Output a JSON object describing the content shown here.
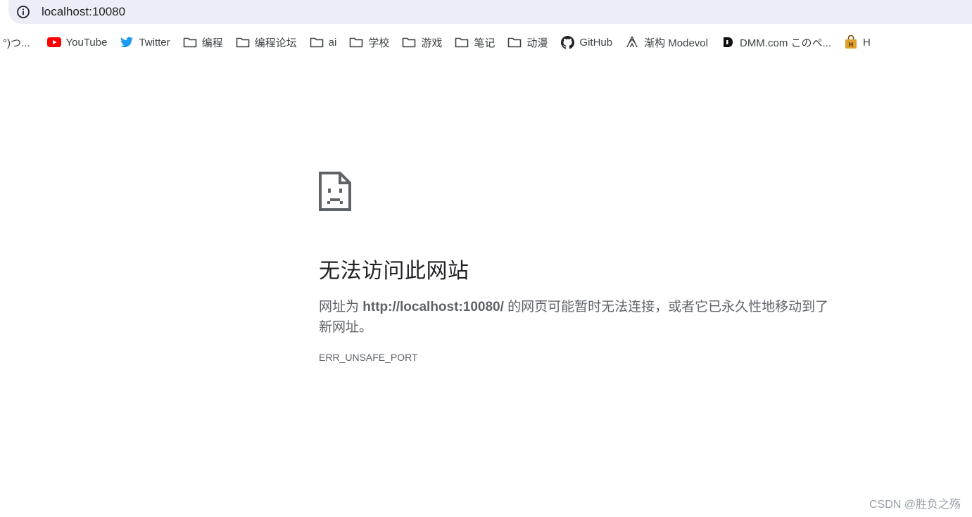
{
  "address_bar": {
    "url": "localhost:10080"
  },
  "bookmarks": [
    {
      "label": "°)つ...",
      "icon": "none"
    },
    {
      "label": "YouTube",
      "icon": "youtube-icon"
    },
    {
      "label": "Twitter",
      "icon": "twitter-icon"
    },
    {
      "label": "编程",
      "icon": "folder-icon"
    },
    {
      "label": "编程论坛",
      "icon": "folder-icon"
    },
    {
      "label": "ai",
      "icon": "folder-icon"
    },
    {
      "label": "学校",
      "icon": "folder-icon"
    },
    {
      "label": "游戏",
      "icon": "folder-icon"
    },
    {
      "label": "笔记",
      "icon": "folder-icon"
    },
    {
      "label": "动漫",
      "icon": "folder-icon"
    },
    {
      "label": "GitHub",
      "icon": "github-icon"
    },
    {
      "label": "渐构 Modevol",
      "icon": "modevol-icon"
    },
    {
      "label": "DMM.com このペ...",
      "icon": "dmm-icon"
    },
    {
      "label": "H",
      "icon": "bag-icon"
    }
  ],
  "error": {
    "title": "无法访问此网站",
    "desc_prefix": "网址为 ",
    "desc_url": "http://localhost:10080/",
    "desc_suffix": " 的网页可能暂时无法连接，或者它已永久性地移动到了新网址。",
    "code": "ERR_UNSAFE_PORT"
  },
  "watermark": "CSDN @胜负之殇",
  "colors": {
    "youtube": "#ff0000",
    "twitter": "#1d9bf0",
    "address_bg": "#ebeef6",
    "text_muted": "#5f6368",
    "bag": "#e0a030"
  }
}
